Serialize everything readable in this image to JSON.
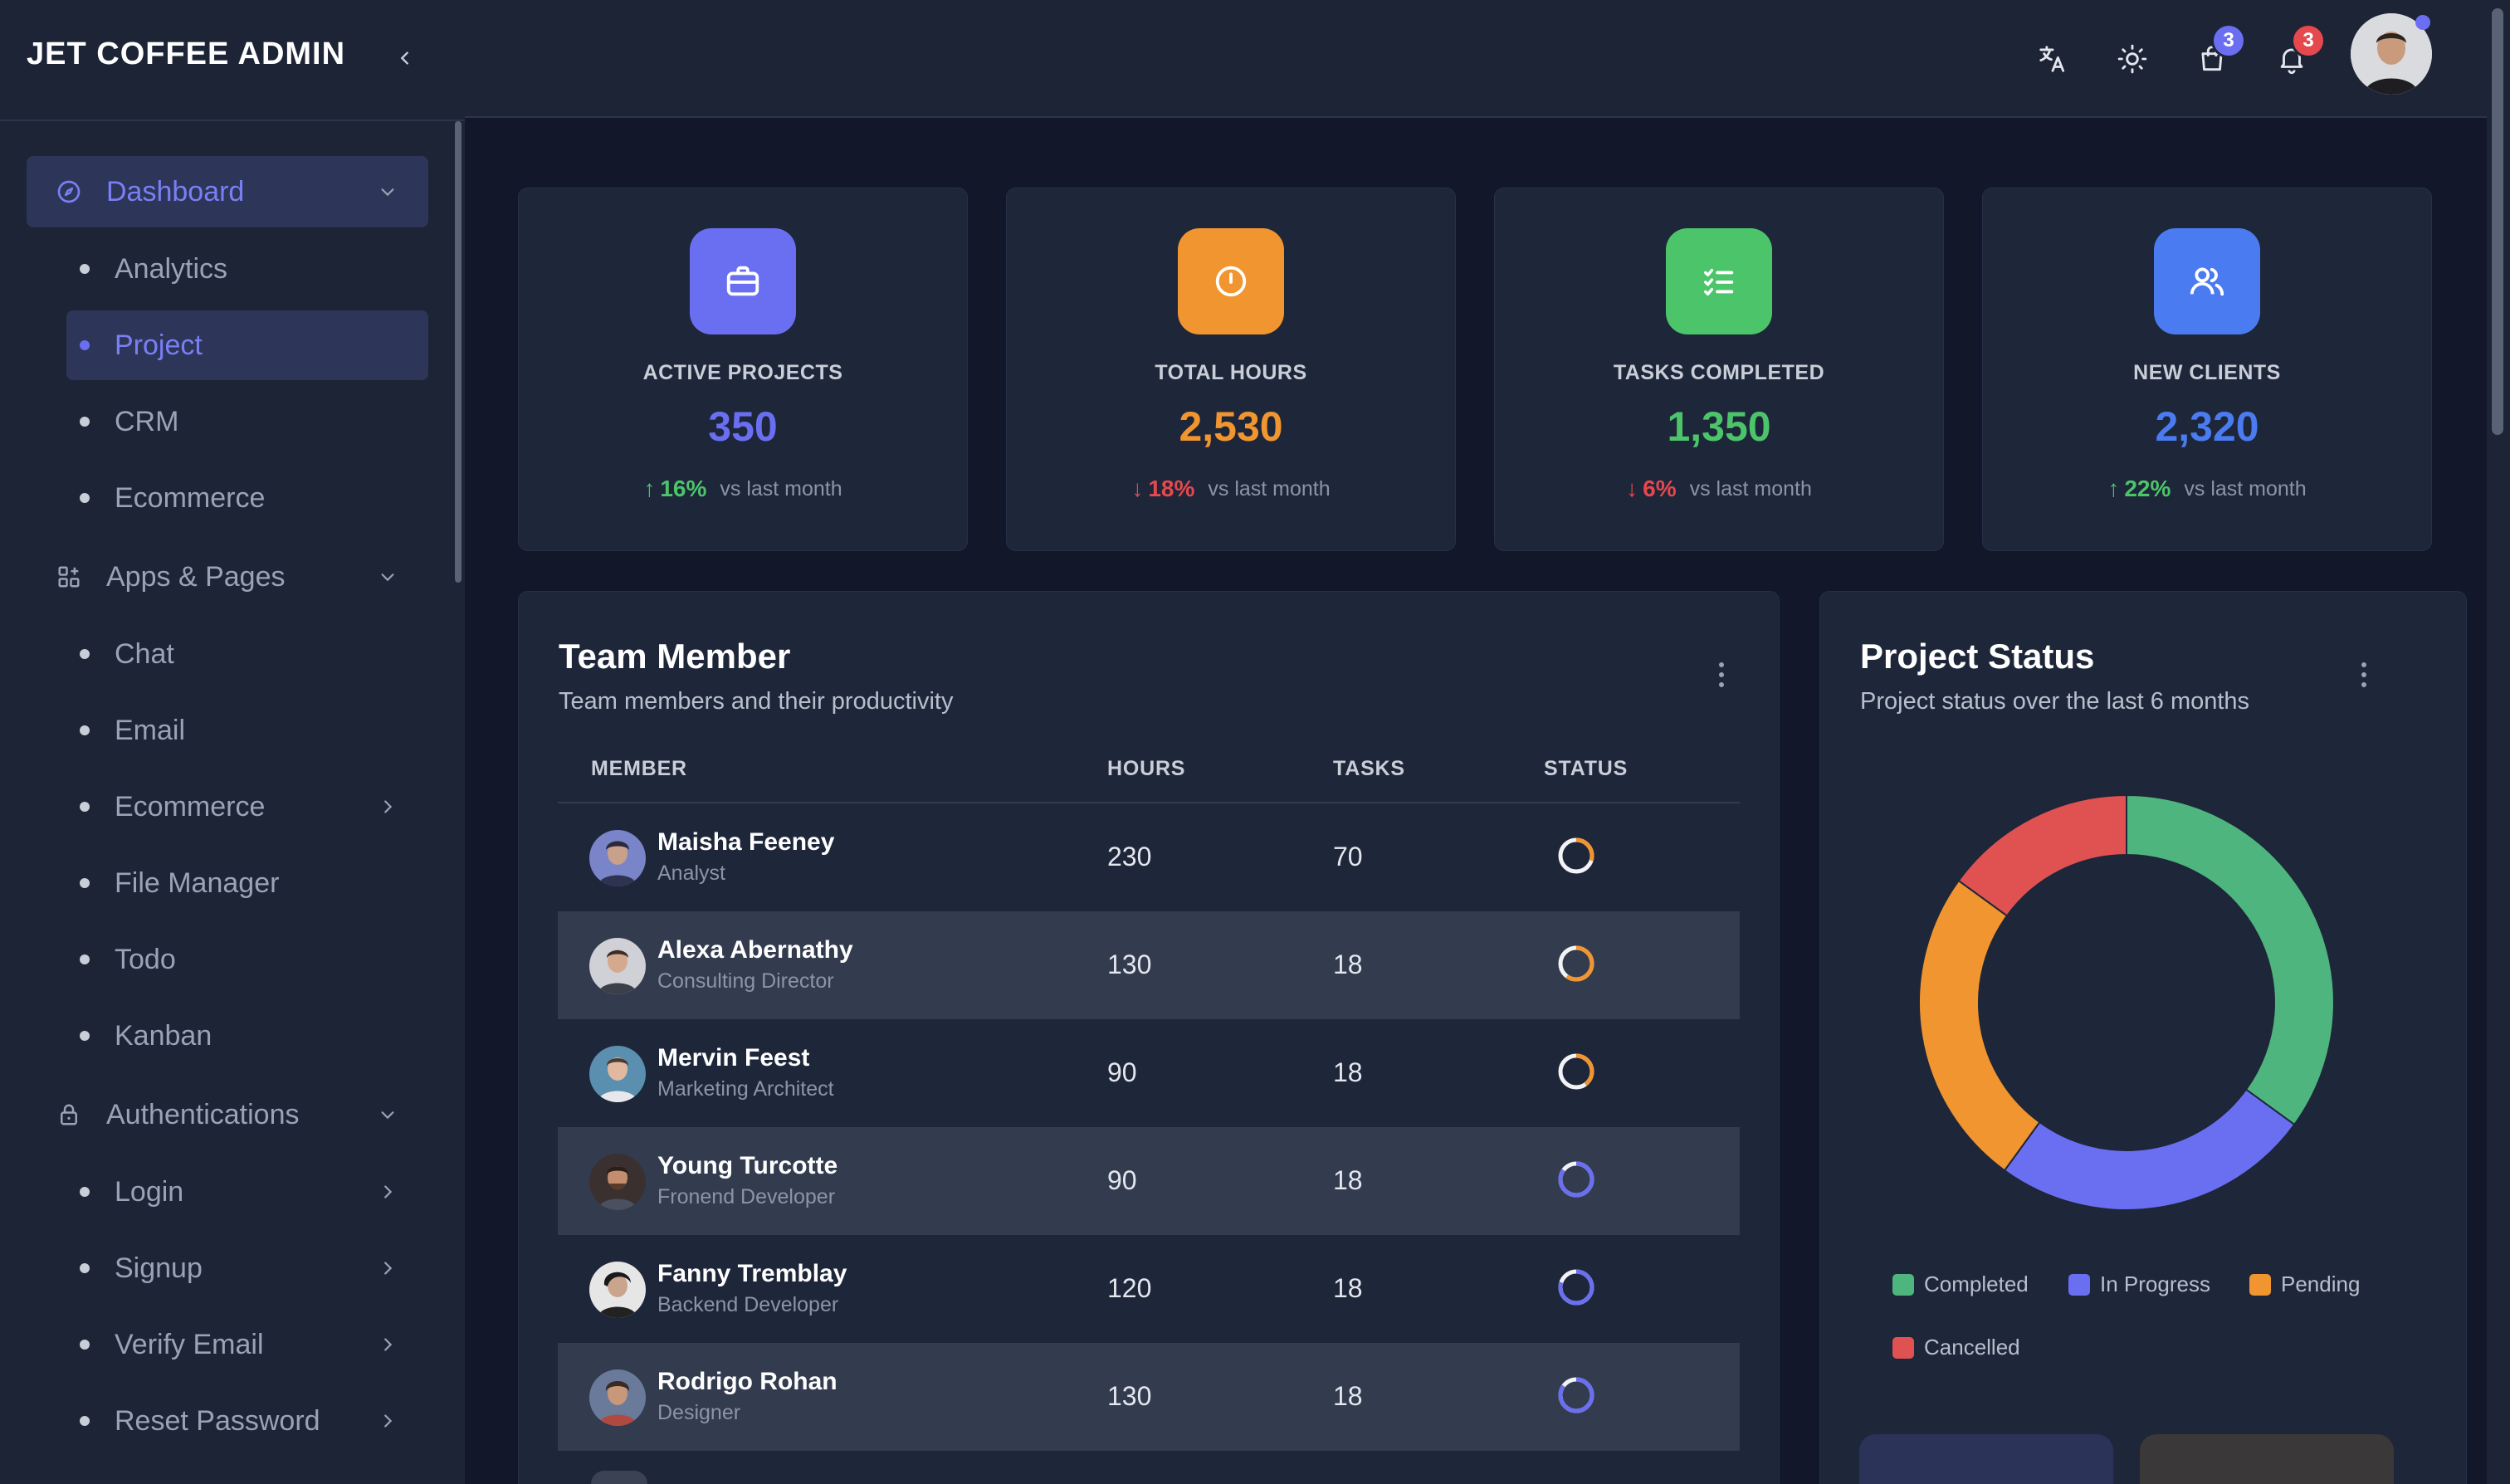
{
  "brand": "JET COFFEE ADMIN",
  "sidebar": {
    "groups": [
      {
        "label": "Dashboard"
      },
      {
        "label": "Apps & Pages"
      },
      {
        "label": "Authentications"
      }
    ],
    "items": [
      {
        "label": "Analytics"
      },
      {
        "label": "Project"
      },
      {
        "label": "CRM"
      },
      {
        "label": "Ecommerce"
      },
      {
        "label": "Chat"
      },
      {
        "label": "Email"
      },
      {
        "label": "Ecommerce"
      },
      {
        "label": "File Manager"
      },
      {
        "label": "Todo"
      },
      {
        "label": "Kanban"
      },
      {
        "label": "Login"
      },
      {
        "label": "Signup"
      },
      {
        "label": "Verify Email"
      },
      {
        "label": "Reset Password"
      }
    ]
  },
  "header": {
    "cart_badge": "3",
    "notification_badge": "3"
  },
  "stats": [
    {
      "label": "ACTIVE PROJECTS",
      "value": "350",
      "arrow": "↑",
      "pct": "16%",
      "vs": "vs last month",
      "color": "#6a6ff2",
      "trend_color": "#4cc46a",
      "icon": "briefcase-icon"
    },
    {
      "label": "TOTAL HOURS",
      "value": "2,530",
      "arrow": "↓",
      "pct": "18%",
      "vs": "vs last month",
      "color": "#f0952f",
      "trend_color": "#e5484d",
      "icon": "clock-icon"
    },
    {
      "label": "TASKS COMPLETED",
      "value": "1,350",
      "arrow": "↓",
      "pct": "6%",
      "vs": "vs last month",
      "color": "#4cc46a",
      "trend_color": "#e5484d",
      "icon": "checklist-icon"
    },
    {
      "label": "NEW CLIENTS",
      "value": "2,320",
      "arrow": "↑",
      "pct": "22%",
      "vs": "vs last month",
      "color": "#4a7bf0",
      "trend_color": "#4cc46a",
      "icon": "users-icon"
    }
  ],
  "team": {
    "title": "Team Member",
    "subtitle": "Team members and their productivity",
    "columns": [
      "MEMBER",
      "HOURS",
      "TASKS",
      "STATUS"
    ],
    "rows": [
      {
        "name": "Maisha Feeney",
        "role": "Analyst",
        "hours": "230",
        "tasks": "70",
        "status_color": "#f0952f",
        "progress": 0.3
      },
      {
        "name": "Alexa Abernathy",
        "role": "Consulting Director",
        "hours": "130",
        "tasks": "18",
        "status_color": "#f0952f",
        "progress": 0.6
      },
      {
        "name": "Mervin Feest",
        "role": "Marketing Architect",
        "hours": "90",
        "tasks": "18",
        "status_color": "#f0952f",
        "progress": 0.4
      },
      {
        "name": "Young Turcotte",
        "role": "Fronend Developer",
        "hours": "90",
        "tasks": "18",
        "status_color": "#6a6ff2",
        "progress": 0.85
      },
      {
        "name": "Fanny Tremblay",
        "role": "Backend Developer",
        "hours": "120",
        "tasks": "18",
        "status_color": "#6a6ff2",
        "progress": 0.8
      },
      {
        "name": "Rodrigo Rohan",
        "role": "Designer",
        "hours": "130",
        "tasks": "18",
        "status_color": "#6a6ff2",
        "progress": 0.85
      }
    ]
  },
  "project_status": {
    "title": "Project Status",
    "subtitle": "Project status over the last 6 months",
    "legend": [
      {
        "label": "Completed",
        "color": "#4fb57e"
      },
      {
        "label": "In Progress",
        "color": "#6a6ff2"
      },
      {
        "label": "Pending",
        "color": "#f0952f"
      },
      {
        "label": "Cancelled",
        "color": "#e05252"
      }
    ]
  },
  "chart_data": {
    "type": "pie",
    "categories": [
      "Completed",
      "In Progress",
      "Pending",
      "Cancelled"
    ],
    "values": [
      35,
      25,
      25,
      15
    ],
    "colors": [
      "#4fb57e",
      "#6a6ff2",
      "#f0952f",
      "#e05252"
    ],
    "legend": "bottom"
  }
}
